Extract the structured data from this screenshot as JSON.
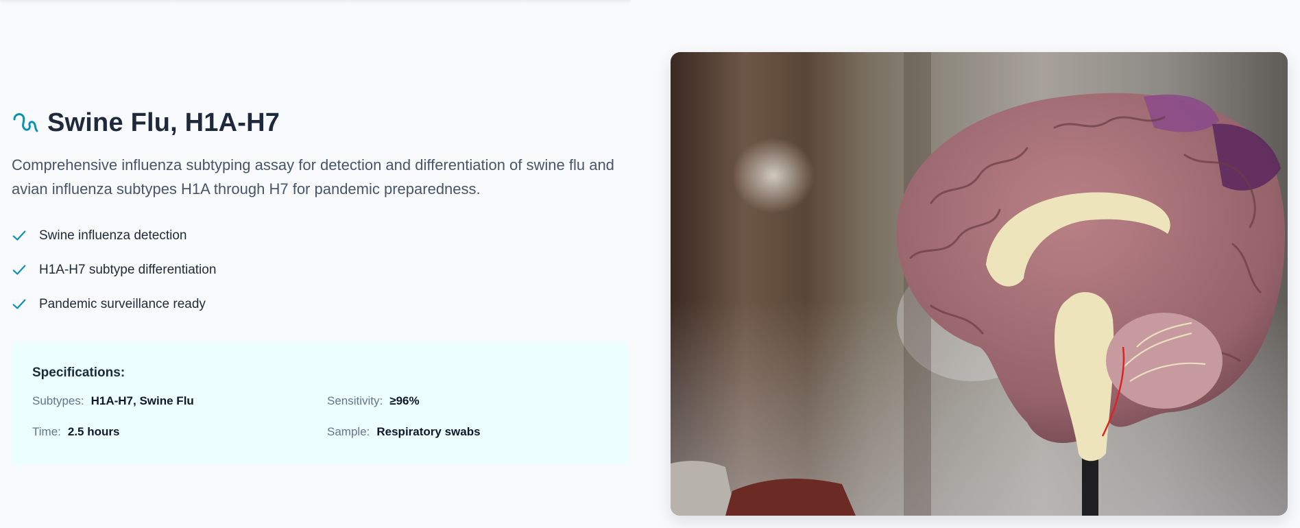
{
  "product": {
    "title": "Swine Flu, H1A-H7",
    "icon": "virus-squiggle-icon",
    "description": "Comprehensive influenza subtyping assay for detection and differentiation of swine flu and avian influenza subtypes H1A through H7 for pandemic preparedness.",
    "features": [
      "Swine influenza detection",
      "H1A-H7 subtype differentiation",
      "Pandemic surveillance ready"
    ]
  },
  "specifications": {
    "heading": "Specifications:",
    "items": [
      {
        "label": "Subtypes:",
        "value": "H1A-H7, Swine Flu"
      },
      {
        "label": "Sensitivity:",
        "value": "≥96%"
      },
      {
        "label": "Time:",
        "value": "2.5 hours"
      },
      {
        "label": "Sample:",
        "value": "Respiratory swabs"
      }
    ]
  },
  "colors": {
    "accent": "#0891b2",
    "background": "#f8fafc",
    "spec_background": "#ecfeff"
  }
}
